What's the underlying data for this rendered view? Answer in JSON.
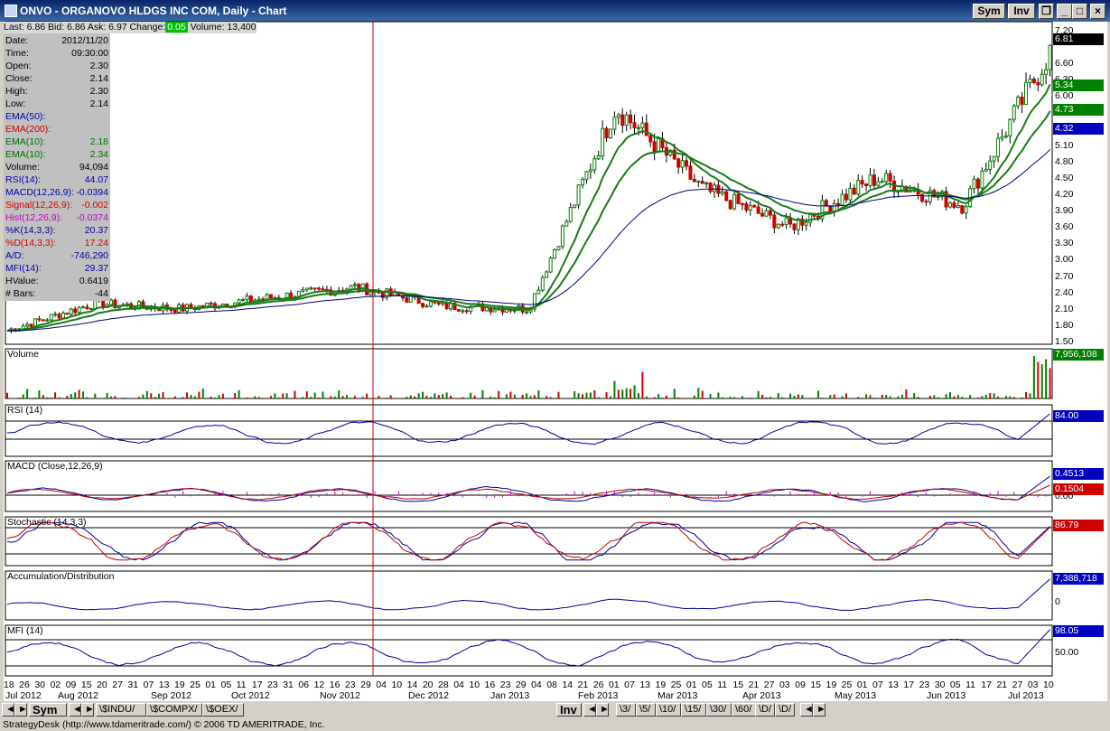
{
  "window": {
    "title": "ONVO - ORGANOVO HLDGS INC COM, Daily - Chart",
    "sym_btn": "Sym",
    "inv_btn": "Inv"
  },
  "quote": {
    "last": "Last: 6.86",
    "bid": "Bid: 6.86",
    "ask": "Ask: 6.97",
    "change_label": "Change:",
    "change": "0.05",
    "volume": "Volume: 13,400"
  },
  "info": [
    {
      "k": "Date:",
      "v": "2012/11/20",
      "c": "#000"
    },
    {
      "k": "Time:",
      "v": "09:30:00",
      "c": "#000"
    },
    {
      "k": "Open:",
      "v": "2.30",
      "c": "#000"
    },
    {
      "k": "Close:",
      "v": "2.14",
      "c": "#000"
    },
    {
      "k": "High:",
      "v": "2.30",
      "c": "#000"
    },
    {
      "k": "Low:",
      "v": "2.14",
      "c": "#000"
    },
    {
      "k": "EMA(50):",
      "v": "",
      "c": "#0000b0"
    },
    {
      "k": "EMA(200):",
      "v": "",
      "c": "#d00000"
    },
    {
      "k": "EMA(10):",
      "v": "2.18",
      "c": "#007000"
    },
    {
      "k": "EMA(10):",
      "v": "2.34",
      "c": "#007000"
    },
    {
      "k": "Volume:",
      "v": "94,094",
      "c": "#000"
    },
    {
      "k": "RSI(14):",
      "v": "44.07",
      "c": "#0000b0"
    },
    {
      "k": "MACD(12,26,9):",
      "v": "-0.0394",
      "c": "#0000b0"
    },
    {
      "k": "Signal(12,26,9):",
      "v": "-0.002",
      "c": "#d00000"
    },
    {
      "k": "Hist(12,26,9):",
      "v": "-0.0374",
      "c": "#c000c0"
    },
    {
      "k": "%K(14,3,3):",
      "v": "20.37",
      "c": "#0000b0"
    },
    {
      "k": "%D(14,3,3):",
      "v": "17.24",
      "c": "#d00000"
    },
    {
      "k": "A/D:",
      "v": "-746,290",
      "c": "#0000b0"
    },
    {
      "k": "MFI(14):",
      "v": "29.37",
      "c": "#0000b0"
    },
    {
      "k": "HValue:",
      "v": "0.6419",
      "c": "#000"
    },
    {
      "k": "# Bars:",
      "v": "-44",
      "c": "#000"
    }
  ],
  "panels": {
    "volume": "Volume",
    "rsi": "RSI (14)",
    "macd": "MACD (Close,12,26,9)",
    "stoch": "Stochastic (14,3,3)",
    "ad": "Accumulation/Distribution",
    "mfi": "MFI (14)"
  },
  "price_scale": [
    "7.20",
    "6.60",
    "6.30",
    "6.00",
    "5.70",
    "5.40",
    "5.10",
    "4.80",
    "4.50",
    "4.20",
    "3.90",
    "3.60",
    "3.30",
    "3.00",
    "2.70",
    "2.40",
    "2.10",
    "1.80",
    "1.50"
  ],
  "tags": {
    "price": "6.81",
    "ema_a": "5.34",
    "ema_b": "4.73",
    "ema50": "4.32",
    "volume": "7,956,108",
    "rsi": "84.00",
    "macd": "0.4513",
    "signal": "0.1504",
    "macd_zero": "0.00",
    "stoch": "86.79",
    "ad": "7,388,718",
    "ad_zero": "0",
    "mfi": "98.05",
    "mfi_mid": "50.00"
  },
  "x_days": [
    "18",
    "26",
    "30",
    "02",
    "09",
    "15",
    "20",
    "27",
    "31",
    "07",
    "13",
    "19",
    "25",
    "01",
    "05",
    "11",
    "17",
    "23",
    "31",
    "06",
    "12",
    "16",
    "23",
    "29",
    "04",
    "10",
    "14",
    "20",
    "28",
    "04",
    "10",
    "16",
    "23",
    "29",
    "04",
    "08",
    "14",
    "21",
    "26",
    "01",
    "07",
    "13",
    "19",
    "25",
    "01",
    "05",
    "11",
    "15",
    "21",
    "27",
    "03",
    "09",
    "15",
    "19",
    "25",
    "01",
    "07",
    "13",
    "17",
    "23",
    "30",
    "05",
    "11",
    "17",
    "21",
    "27",
    "03",
    "10"
  ],
  "x_months": [
    "Jul 2012",
    "Aug 2012",
    "Sep 2012",
    "Oct 2012",
    "Nov 2012",
    "Dec 2012",
    "Jan 2013",
    "Feb 2013",
    "Mar 2013",
    "Apr 2013",
    "May 2013",
    "Jun 2013",
    "Jul 2013"
  ],
  "bottom": {
    "sym": "Sym",
    "tabs": [
      "$INDU",
      "$COMPX",
      "$OEX"
    ],
    "inv": "Inv",
    "intervals": [
      "3",
      "5",
      "10",
      "15",
      "30",
      "60",
      "D",
      "D"
    ]
  },
  "status": "StrategyDesk  (http://www.tdameritrade.com/)  © 2006 TD AMERITRADE, Inc.",
  "colors": {
    "up": "#008000",
    "down": "#d00000",
    "ema": "#1a7a1a",
    "ema50": "#000080",
    "cursor": "#c00000"
  },
  "chart_data": [
    {
      "type": "line",
      "title": "ONVO - ORGANOVO HLDGS INC COM, Daily",
      "ylim": [
        1.5,
        7.3
      ],
      "categories": [
        "Jul 2012",
        "Aug 2012",
        "Sep 2012",
        "Oct 2012",
        "Nov 2012",
        "Dec 2012",
        "Jan 2013",
        "Feb 2013",
        "Mar 2013",
        "Apr 2013",
        "May 2013",
        "Jun 2013",
        "Jul 2013"
      ],
      "series": [
        {
          "name": "Close",
          "values": [
            1.7,
            2.2,
            2.1,
            2.3,
            2.5,
            2.15,
            2.1,
            5.8,
            4.3,
            3.6,
            4.5,
            4.0,
            6.81
          ]
        }
      ]
    },
    {
      "type": "line",
      "title": "RSI (14)",
      "series": [
        {
          "name": "RSI (14)",
          "values": [
            44.07,
            84.0
          ]
        }
      ]
    },
    {
      "type": "line",
      "title": "MACD (Close,12,26,9)",
      "series": [
        {
          "name": "MACD",
          "values": [
            -0.0394,
            0.4513
          ]
        },
        {
          "name": "Signal",
          "values": [
            -0.002,
            0.1504
          ]
        }
      ]
    },
    {
      "type": "line",
      "title": "Stochastic (14,3,3)",
      "series": [
        {
          "name": "%K",
          "values": [
            20.37,
            86.79
          ]
        },
        {
          "name": "%D",
          "values": [
            17.24
          ]
        }
      ]
    },
    {
      "type": "line",
      "title": "Accumulation/Distribution",
      "series": [
        {
          "name": "A/D",
          "values": [
            -746290,
            7388718
          ]
        }
      ]
    },
    {
      "type": "line",
      "title": "MFI (14)",
      "series": [
        {
          "name": "MFI (14)",
          "values": [
            29.37,
            98.05
          ]
        }
      ]
    }
  ]
}
